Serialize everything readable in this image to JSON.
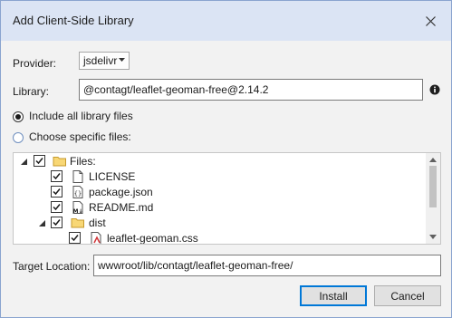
{
  "dialog": {
    "title": "Add Client-Side Library"
  },
  "provider": {
    "label": "Provider:",
    "value": "jsdelivr"
  },
  "library": {
    "label": "Library:",
    "value": "@contagt/leaflet-geoman-free@2.14.2"
  },
  "options": {
    "include_all": "Include all library files",
    "choose_specific": "Choose specific files:",
    "selected": "include_all"
  },
  "tree": {
    "items": [
      {
        "label": "Files:",
        "icon": "folder-icon",
        "checked": true,
        "expanded": true
      },
      {
        "label": "LICENSE",
        "icon": "file-icon",
        "checked": true
      },
      {
        "label": "package.json",
        "icon": "json-file-icon",
        "checked": true
      },
      {
        "label": "README.md",
        "icon": "markdown-file-icon",
        "checked": true
      },
      {
        "label": "dist",
        "icon": "folder-icon",
        "checked": true,
        "expanded": true
      },
      {
        "label": "leaflet-geoman.css",
        "icon": "css-file-icon",
        "checked": true
      }
    ]
  },
  "target": {
    "label": "Target Location:",
    "value": "wwwroot/lib/contagt/leaflet-geoman-free/"
  },
  "buttons": {
    "install": "Install",
    "cancel": "Cancel"
  }
}
